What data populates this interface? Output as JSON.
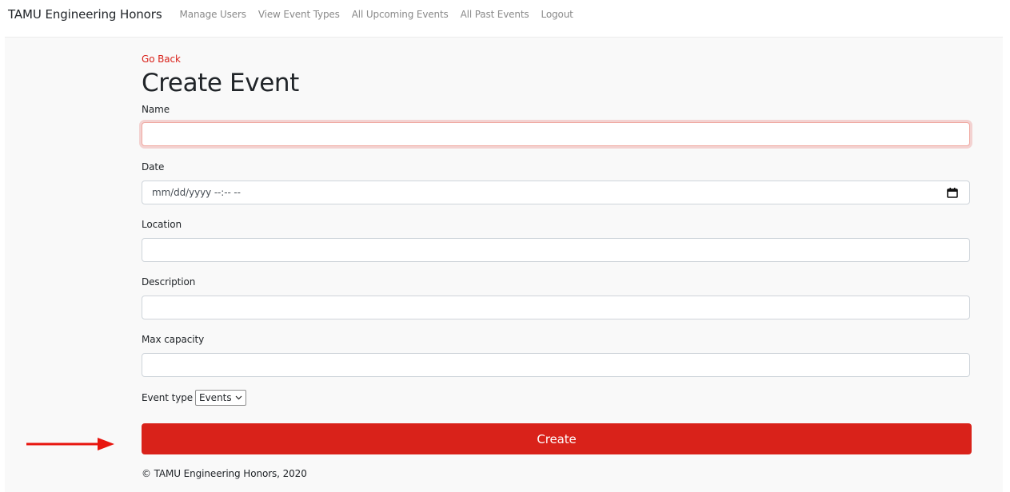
{
  "navbar": {
    "brand": "TAMU Engineering Honors",
    "links": [
      {
        "label": "Manage Users"
      },
      {
        "label": "View Event Types"
      },
      {
        "label": "All Upcoming Events"
      },
      {
        "label": "All Past Events"
      },
      {
        "label": "Logout"
      }
    ]
  },
  "page": {
    "go_back": "Go Back",
    "title": "Create Event"
  },
  "form": {
    "name": {
      "label": "Name",
      "value": ""
    },
    "date": {
      "label": "Date",
      "placeholder": "mm/dd/yyyy --:-- --",
      "icon": "calendar-icon"
    },
    "location": {
      "label": "Location",
      "value": ""
    },
    "description": {
      "label": "Description",
      "value": ""
    },
    "max_capacity": {
      "label": "Max capacity",
      "value": ""
    },
    "event_type": {
      "label": "Event type",
      "selected": "Events"
    },
    "submit_label": "Create"
  },
  "footer": {
    "text": "© TAMU Engineering Honors, 2020"
  },
  "annotation": {
    "icon": "arrow-right-icon",
    "color": "#e8150e"
  },
  "colors": {
    "accent": "#d9221a",
    "nav_link": "#8a8a8a",
    "background": "#f9f9f9"
  }
}
